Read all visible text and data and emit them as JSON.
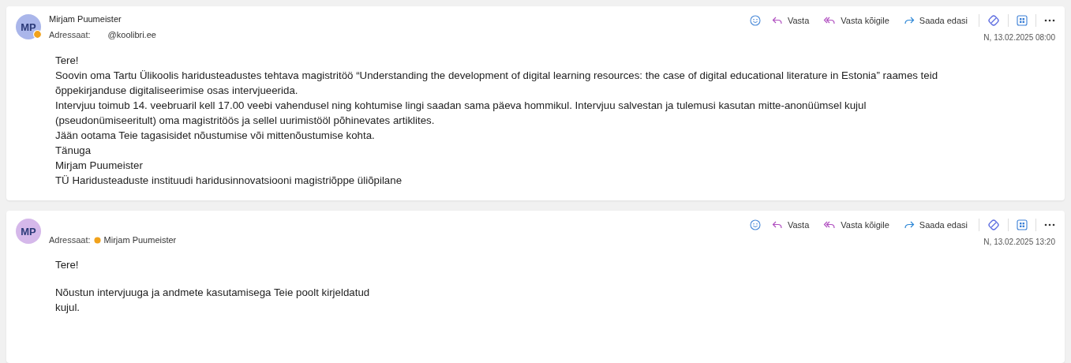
{
  "messages": [
    {
      "avatar": {
        "initials": "MP",
        "color": "#aab6ea",
        "away": true
      },
      "sender": "Mirjam Puumeister",
      "to_label": "Adressaat:",
      "recipient": {
        "name": "@koolibri.ee",
        "away": false
      },
      "actions": [
        "Vasta",
        "Vasta kõigile",
        "Saada edasi"
      ],
      "date": "N, 13.02.2025 08:00",
      "paragraphs": [
        [
          "Tere!",
          "Soovin oma Tartu Ülikoolis haridusteadustes tehtava magistritöö “Understanding the development of digital learning resources: the case of digital educational literature in Estonia” raames teid",
          "õppekirjanduse digitaliseerimise osas  intervjueerida.",
          "Intervjuu toimub 14. veebruaril kell 17.00 veebi vahendusel ning kohtumise lingi saadan sama päeva hommikul. Intervjuu salvestan ja tulemusi kasutan mitte-anonüümsel kujul",
          "(pseudonümiseeritult) oma magistritöös ja sellel uurimistööl põhinevates artiklites.",
          "Jään ootama Teie tagasisidet nõustumise või mittenõustumise kohta.",
          "Tänuga",
          "Mirjam Puumeister",
          "TÜ Haridusteaduste instituudi haridusinnovatsiooni magistriõppe üliõpilane"
        ]
      ]
    },
    {
      "avatar": {
        "initials": "MP",
        "color": "#d5b8ea",
        "away": false
      },
      "to_label": "Adressaat:",
      "recipient": {
        "name": "Mirjam Puumeister",
        "away": true
      },
      "actions": [
        "Vasta",
        "Vasta kõigile",
        "Saada edasi"
      ],
      "date": "N, 13.02.2025 13:20",
      "paragraphs": [
        [
          "Tere!"
        ],
        [
          "Nõustun intervjuuga ja andmete kasutamisega Teie poolt kirjeldatud",
          "kujul."
        ]
      ]
    }
  ]
}
